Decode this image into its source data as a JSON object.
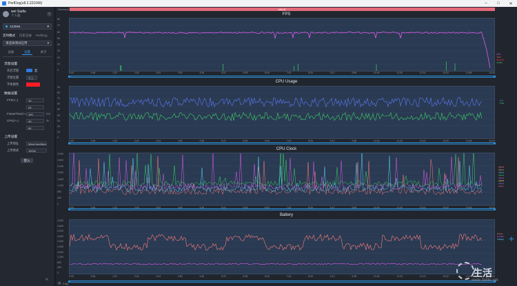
{
  "window": {
    "title": "PerfDog(v8.2.221040)"
  },
  "sidebar": {
    "user_name": "wei Sadlu",
    "user_sub": "个人版",
    "device": "X23594",
    "mode_tabs": [
      "实时模式",
      "历史记录",
      "PerfDog"
    ],
    "app": "请选择测试应用",
    "sub_tabs": [
      "设备",
      "设置",
      "关于"
    ],
    "float_section": "浮窗设置",
    "float_rows": [
      {
        "label": "开启浮窗",
        "value": "显"
      },
      {
        "label": "浮窗位置",
        "value": "左上"
      },
      {
        "label": "字体颜色",
        "value": ""
      }
    ],
    "data_section": "数据设置",
    "data_rows": [
      {
        "label": "FPS(>=)",
        "value": "10",
        "unit": ""
      },
      {
        "label": "",
        "value": "25",
        "unit": ""
      },
      {
        "label": "FrameTime(>=)",
        "value": "100",
        "unit": "ms"
      },
      {
        "label": "CPU(>=)",
        "value": "40",
        "unit": "%"
      },
      {
        "label": "",
        "value": "80",
        "unit": ""
      }
    ],
    "upload_section": "上传设置",
    "upload_rows": [
      {
        "label": "上传地址",
        "value": "https://perfdog.q"
      },
      {
        "label": "上传格式",
        "value": "JSON"
      }
    ],
    "login_label": "登入",
    "collapse_icon": "«"
  },
  "main": {
    "top_left_label": "Game(ce)",
    "label_bar": "label1",
    "x_ticks": [
      "0:00",
      "0:46",
      "1:32",
      "2:18",
      "3:04",
      "3:50",
      "4:36",
      "5:22",
      "6:08",
      "6:54",
      "7:40",
      "8:26",
      "9:12",
      "9:58",
      "10:44",
      "11:30",
      "12:16",
      "13:02",
      "13:48",
      "14:34"
    ],
    "panels": [
      {
        "title": "FPS",
        "y_ticks": [
          "80",
          "70",
          "60",
          "50",
          "40",
          "30",
          "20",
          "10",
          "0"
        ],
        "legend_right": [
          {
            "text": "FPS",
            "color": "#e05cf0"
          },
          {
            "text": "Jank",
            "color": "#ff6666"
          },
          {
            "text": "BigJank",
            "color": "#ff3333"
          },
          {
            "text": "Stutter",
            "color": "#3fd36b"
          }
        ]
      },
      {
        "title": "CPU Usage",
        "y_ticks": [
          "90",
          "80",
          "70",
          "60",
          "50",
          "40",
          "30",
          "20",
          "10",
          "0"
        ],
        "legend_right": [
          {
            "text": "App",
            "color": "#5e7cff"
          },
          {
            "text": "Total",
            "color": "#3fd36b"
          }
        ]
      },
      {
        "title": "CPU Clock",
        "y_ticks": [
          "3,000",
          "2,800",
          "2,400",
          "2,000",
          "1,600",
          "1,200",
          "800",
          "400",
          "0"
        ],
        "legend_right": [
          {
            "text": "CPU0",
            "color": "#ff8080"
          },
          {
            "text": "CPU1",
            "color": "#ffb060"
          },
          {
            "text": "CPU2",
            "color": "#5fd3ff"
          },
          {
            "text": "CPU3",
            "color": "#3fd36b"
          },
          {
            "text": "CPU4",
            "color": "#e05cf0"
          },
          {
            "text": "CPU5",
            "color": "#ffe060"
          },
          {
            "text": "CPU6",
            "color": "#8c7cff"
          },
          {
            "text": "CPU7",
            "color": "#ff5c8c"
          }
        ]
      },
      {
        "title": "Battery",
        "y_ticks": [
          "4,000",
          "3,600",
          "3,200",
          "2,800",
          "2,400",
          "2,000",
          "1,600",
          "1,200",
          "800",
          "400",
          "0"
        ],
        "legend_right": [
          {
            "text": "Power",
            "color": "#ff8080"
          },
          {
            "text": "Current",
            "color": "#e05cf0"
          },
          {
            "text": "Voltage",
            "color": "#5fd3ff"
          }
        ]
      }
    ],
    "bottom_label": "Log"
  },
  "watermark": {
    "brand": "生活",
    "url": "www.3elife.net"
  },
  "colors": {
    "accent": "#2f8fd8",
    "plot_bg": "#2a3a52",
    "fps": "#e05cf0",
    "cpu_app": "#5e7cff",
    "cpu_total": "#3fd36b",
    "battery": "#ff8080"
  }
}
